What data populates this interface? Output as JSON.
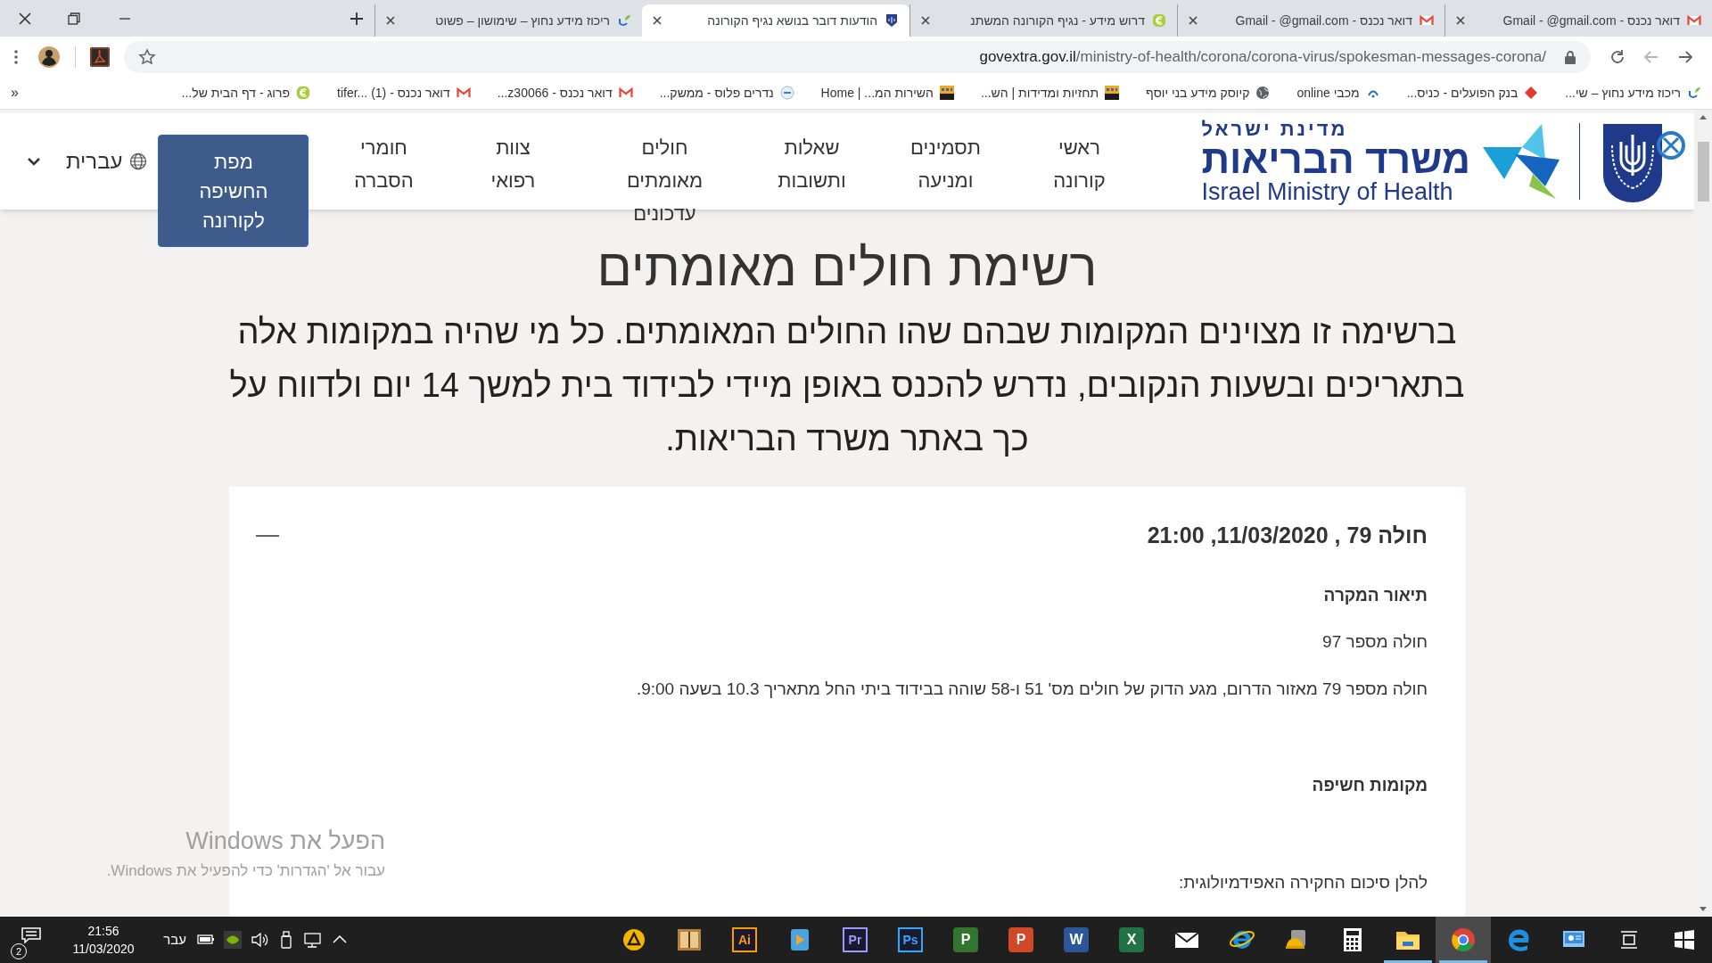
{
  "browser": {
    "tabs": [
      {
        "title": "דואר נכנס - Gmail - @gmail.com",
        "kind": "mail",
        "selected": false
      },
      {
        "title": "דואר נכנס - Gmail - @gmail.com",
        "kind": "mail",
        "selected": false
      },
      {
        "title": "דרוש מידע - נגיף הקורונה המשתנ",
        "kind": "swirl",
        "selected": false
      },
      {
        "title": "הודעות דובר בנושא נגיף הקורונה",
        "kind": "emblem",
        "selected": true
      },
      {
        "title": "ריכוז מידע נחוץ – שימושון – פשוט",
        "kind": "leaf",
        "selected": false
      }
    ],
    "address": {
      "host": "govextra.gov.il",
      "path": "/ministry-of-health/corona/corona-virus/spokesman-messages-corona/"
    },
    "bookmarks": [
      {
        "label": "ריכוז מידע נחוץ – שי...",
        "kind": "leaf"
      },
      {
        "label": "בנק הפועלים - כניס...",
        "kind": "diamond"
      },
      {
        "label": "מכבי online",
        "kind": "arc"
      },
      {
        "label": "קיוסק מידע בני יוסף",
        "kind": "globe"
      },
      {
        "label": "תחזיות ומדידות | הש...",
        "kind": "tile"
      },
      {
        "label": "השירות המ... | Home",
        "kind": "tile"
      },
      {
        "label": "נדרים פלוס - ממשק...",
        "kind": "ring"
      },
      {
        "label": "דואר נכנס - z30066...",
        "kind": "mail"
      },
      {
        "label": "דואר נכנס - tifer... (1)",
        "kind": "mail"
      },
      {
        "label": "פרוג - דף הבית של...",
        "kind": "swirl"
      }
    ],
    "bookmarks_overflow": "»"
  },
  "site_header": {
    "state_name": "מדינת ישראל",
    "ministry_name": "משרד הבריאות",
    "english_name": "Israel Ministry of Health",
    "nav": [
      {
        "label": "ראשי קורונה",
        "kind": "link"
      },
      {
        "label": "תסמינים ומניעה",
        "kind": "link"
      },
      {
        "label": "שאלות ותשובות",
        "kind": "link"
      },
      {
        "label": "חולים מאומתים עדכונים",
        "kind": "link"
      },
      {
        "label": "צוות רפואי",
        "kind": "link"
      },
      {
        "label": "חומרי הסברה",
        "kind": "link"
      },
      {
        "label": "מפת החשיפה לקורונה",
        "kind": "button"
      }
    ],
    "language": "עברית"
  },
  "page": {
    "heading": "רשימת חולים מאומתים",
    "intro": "ברשימה זו מצוינים המקומות שבהם שהו החולים המאומתים. כל מי שהיה במקומות אלה בתאריכים ובשעות הנקובים, נדרש להכנס באופן מיידי לבידוד בית למשך 14 יום ולדווח על כך באתר משרד הבריאות.",
    "card": {
      "title": "חולה 79 , 11/03/2020, 21:00",
      "expanded": true,
      "blocks": [
        {
          "kind": "heading",
          "text": "תיאור המקרה"
        },
        {
          "kind": "text",
          "text": "חולה מספר 97"
        },
        {
          "kind": "text",
          "text": "חולה מספר 79 מאזור הדרום, מגע הדוק של חולים מס' 51 ו-58 שוהה בבידוד ביתי החל מתאריך 10.3 בשעה 9:00."
        },
        {
          "kind": "gap"
        },
        {
          "kind": "heading",
          "text": "מקומות חשיפה"
        },
        {
          "kind": "gap"
        },
        {
          "kind": "text",
          "text": "להלן סיכום החקירה האפידמיולוגית:"
        }
      ]
    }
  },
  "windows_activation": {
    "title": "הפעל את Windows",
    "subtitle": "עבור אל 'הגדרות' כדי להפעיל את Windows."
  },
  "taskbar": {
    "notification_count": "2",
    "time": "21:56",
    "date": "11/03/2020",
    "language": "עבר",
    "apps": [
      {
        "kind": "start",
        "open": false,
        "selected": false
      },
      {
        "kind": "task-view",
        "open": false,
        "selected": false
      },
      {
        "kind": "panel",
        "open": false,
        "selected": false
      },
      {
        "kind": "wave-browser",
        "open": false,
        "selected": false
      },
      {
        "kind": "round-browser",
        "open": true,
        "selected": true
      },
      {
        "kind": "folder",
        "open": true,
        "selected": false
      },
      {
        "kind": "calculator",
        "open": false,
        "selected": false
      },
      {
        "kind": "helmet",
        "open": false,
        "selected": false
      },
      {
        "kind": "ring-browser",
        "open": false,
        "selected": false
      },
      {
        "kind": "envelope",
        "open": false,
        "selected": false
      },
      {
        "kind": "solid-tile",
        "label": "X",
        "color": "#217346",
        "open": false,
        "selected": false
      },
      {
        "kind": "solid-tile",
        "label": "W",
        "color": "#2b579a",
        "open": false,
        "selected": false
      },
      {
        "kind": "solid-tile",
        "label": "P",
        "color": "#d24726",
        "open": false,
        "selected": false
      },
      {
        "kind": "solid-tile",
        "label": "P",
        "color": "#31752f",
        "open": false,
        "selected": false
      },
      {
        "kind": "outline-tile",
        "label": "Ps",
        "color": "#31a8ff",
        "open": false,
        "selected": false
      },
      {
        "kind": "outline-tile",
        "label": "Pr",
        "color": "#9999ff",
        "open": false,
        "selected": false
      },
      {
        "kind": "play",
        "open": false,
        "selected": false
      },
      {
        "kind": "outline-tile",
        "label": "Ai",
        "color": "#ff9a00",
        "open": false,
        "selected": false
      },
      {
        "kind": "book",
        "open": false,
        "selected": false
      },
      {
        "kind": "badge",
        "open": false,
        "selected": false
      }
    ]
  }
}
